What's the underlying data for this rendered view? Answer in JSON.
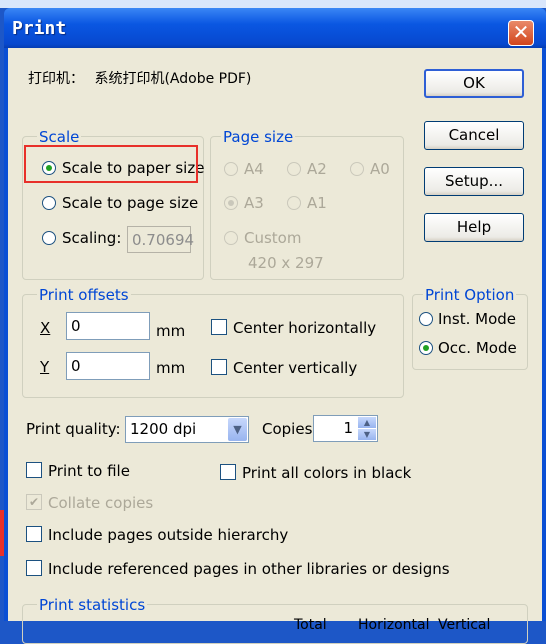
{
  "window": {
    "title": "Print",
    "close_glyph": "✕"
  },
  "printer": {
    "label": "打印机：",
    "name": "系统打印机(Adobe PDF)"
  },
  "buttons": {
    "ok": "OK",
    "cancel": "Cancel",
    "setup": "Setup...",
    "help": "Help"
  },
  "scale": {
    "legend": "Scale",
    "scale_to_paper": "Scale to paper size",
    "scale_to_page": "Scale to page size",
    "scaling": "Scaling:",
    "scaling_value": "0.70694",
    "selected": "scale_to_paper"
  },
  "page_size": {
    "legend": "Page size",
    "options": [
      "A4",
      "A2",
      "A0",
      "A3",
      "A1",
      "Custom"
    ],
    "selected": "A3",
    "custom_dims": "420 x 297"
  },
  "print_offsets": {
    "legend": "Print offsets",
    "x_label": "X",
    "x_value": "0",
    "y_label": "Y",
    "y_value": "0",
    "unit": "mm",
    "center_horizontally": "Center horizontally",
    "center_vertically": "Center vertically"
  },
  "print_option": {
    "legend": "Print Option",
    "inst_mode": "Inst. Mode",
    "occ_mode": "Occ. Mode",
    "selected": "occ_mode"
  },
  "print_quality": {
    "label": "Print quality:",
    "value": "1200 dpi"
  },
  "copies": {
    "label": "Copies:",
    "value": "1"
  },
  "checkboxes": {
    "print_to_file": "Print to file",
    "print_all_black": "Print all colors in black",
    "collate": "Collate copies",
    "include_outside": "Include pages outside hierarchy",
    "include_referenced": "Include referenced pages in other libraries or designs"
  },
  "stats": {
    "legend": "Print statistics",
    "col_total": "Total",
    "col_horizontal": "Horizontal",
    "col_vertical": "Vertical"
  },
  "colors": {
    "accent": "#0046d5",
    "title_bar": "#0a57e2",
    "highlight": "#e8302a",
    "dialog_bg": "#ece9d8"
  }
}
